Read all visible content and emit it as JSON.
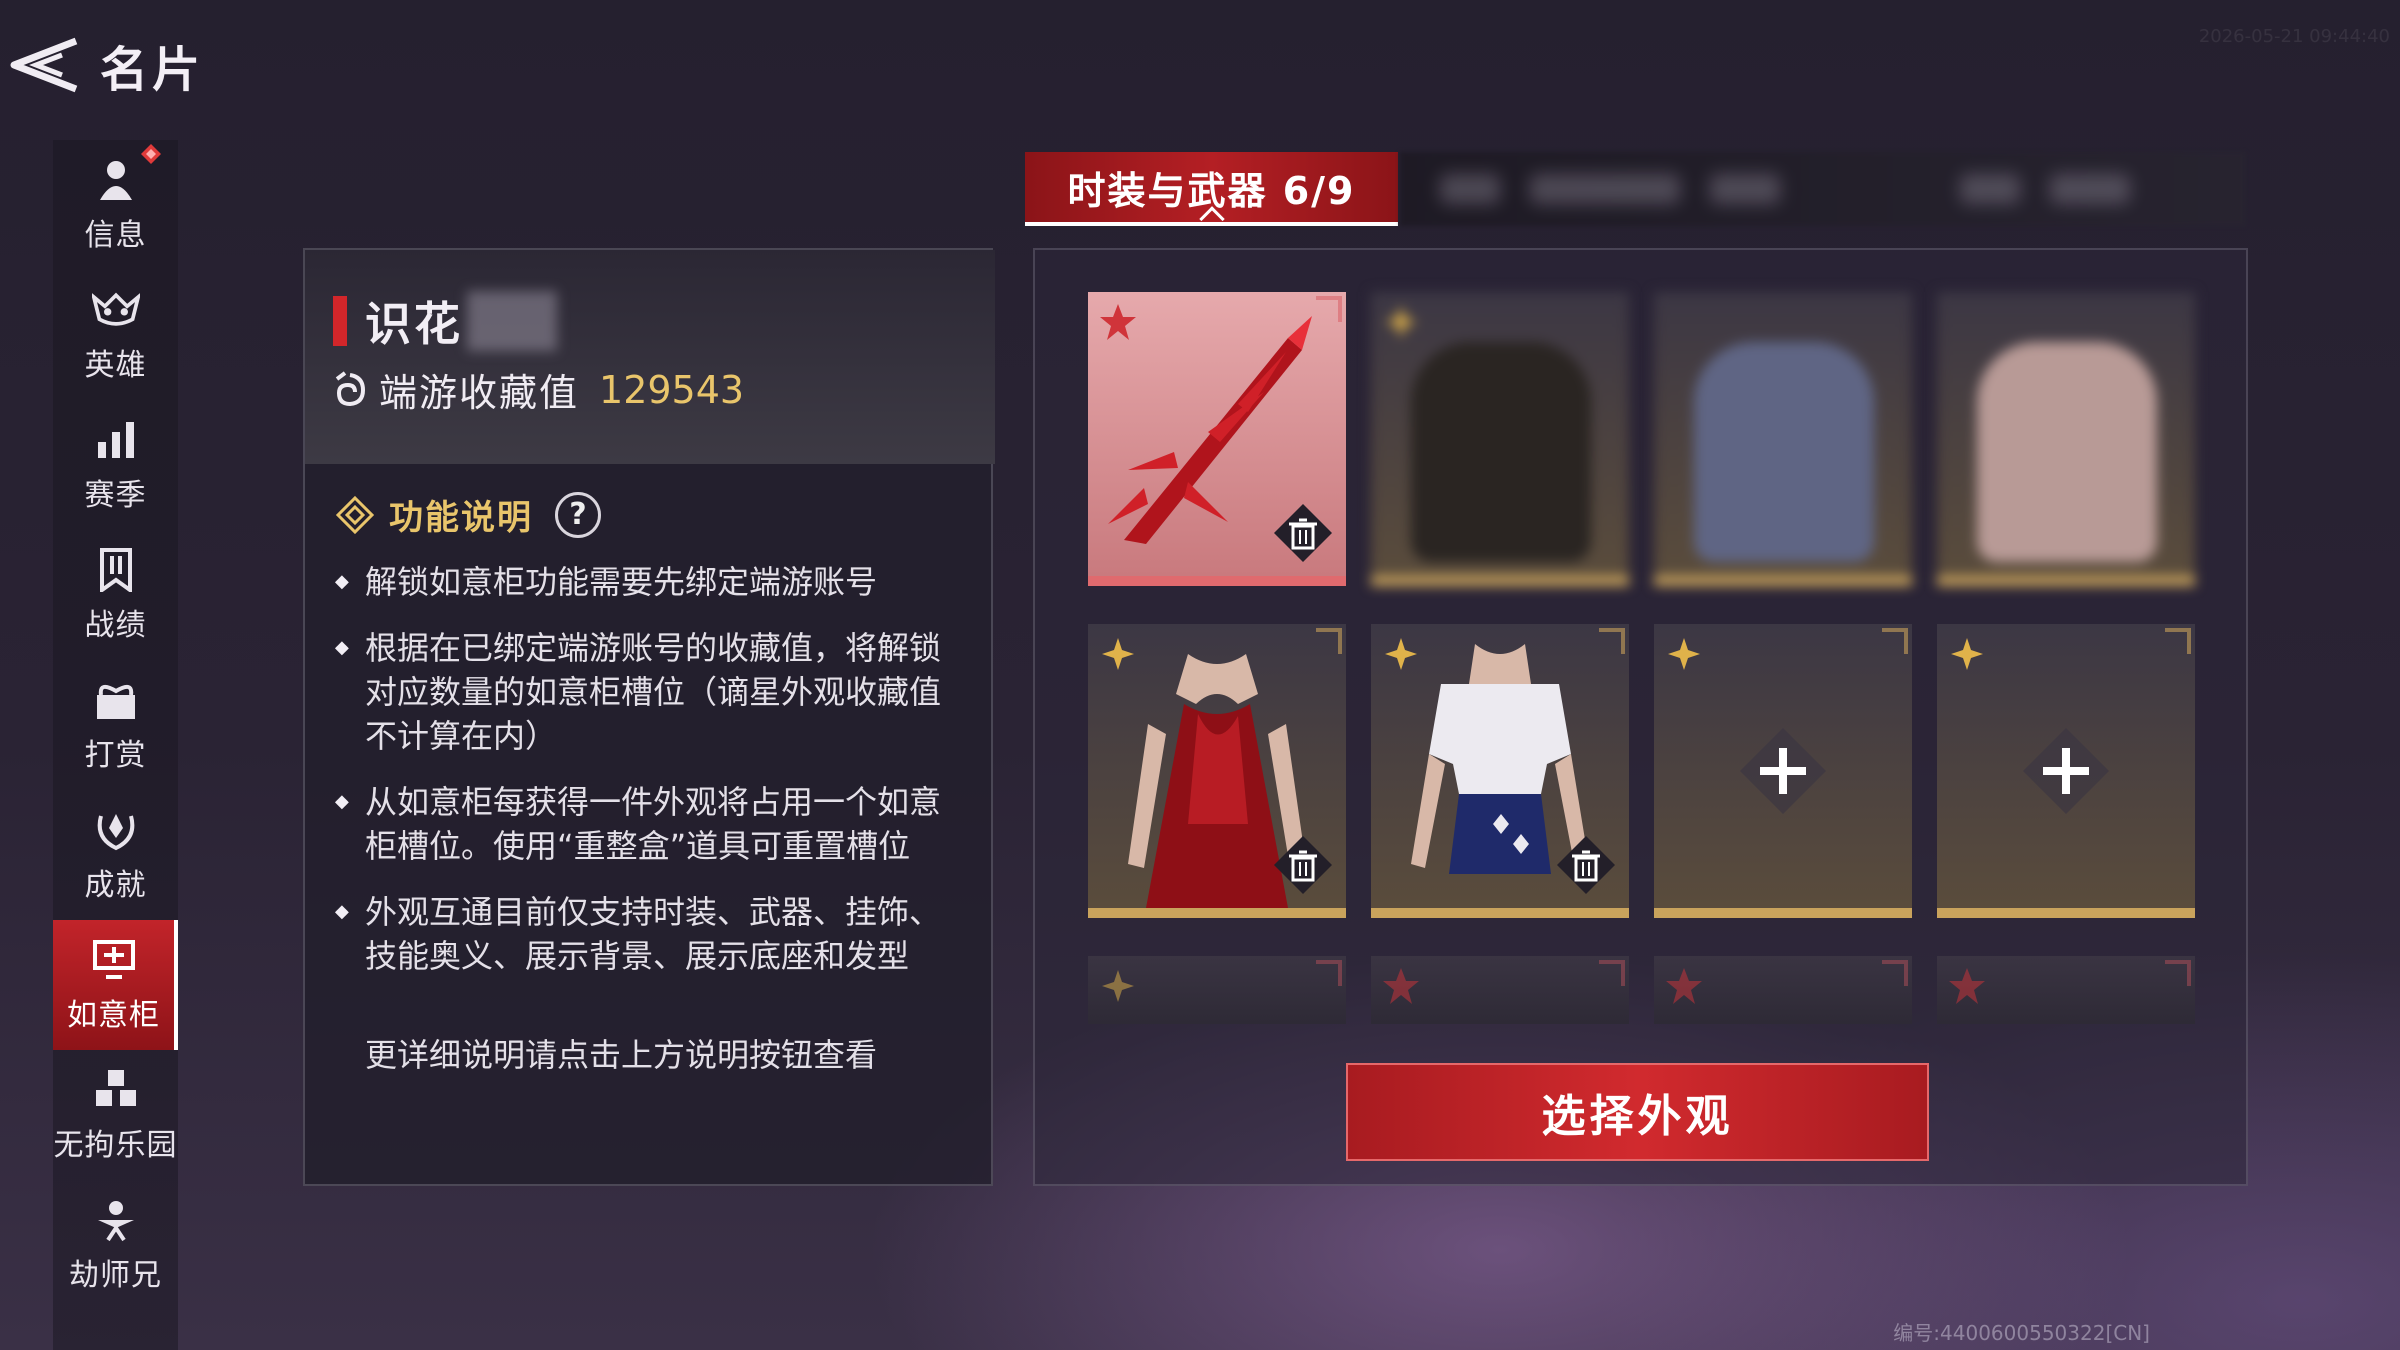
{
  "header": {
    "title": "名片",
    "timestamp": "2026-05-21 09:44:40"
  },
  "sidebar": {
    "items": [
      {
        "label": "信息",
        "icon": "person-icon"
      },
      {
        "label": "英雄",
        "icon": "hero-mask-icon"
      },
      {
        "label": "赛季",
        "icon": "bar-chart-icon"
      },
      {
        "label": "战绩",
        "icon": "banner-icon"
      },
      {
        "label": "打赏",
        "icon": "gift-icon"
      },
      {
        "label": "成就",
        "icon": "laurel-icon"
      },
      {
        "label": "如意柜",
        "icon": "cabinet-icon",
        "active": true
      },
      {
        "label": "无拘乐园",
        "icon": "cubes-icon"
      },
      {
        "label": "劫师兄",
        "icon": "master-icon"
      }
    ]
  },
  "info": {
    "player_name": "识花",
    "collection_label": "端游收藏值",
    "collection_value": "129543",
    "func_title": "功能说明",
    "help_symbol": "?",
    "rules": [
      "解锁如意柜功能需要先绑定端游账号",
      "根据在已绑定端游账号的收藏值，将解锁对应数量的如意柜槽位（谪星外观收藏值不计算在内）",
      "从如意柜每获得一件外观将占用一个如意柜槽位。使用“重整盒”道具可重置槽位",
      "外观互通目前仅支持时装、武器、挂饰、技能奥义、展示背景、展示底座和发型"
    ],
    "footnote": "更详细说明请点击上方说明按钮查看"
  },
  "tabs": {
    "active_label": "时装与武器 6/9"
  },
  "slots": [
    {
      "kind": "weapon",
      "rarity": "red",
      "deletable": true
    },
    {
      "kind": "blurred",
      "rarity": "gold",
      "deletable": false
    },
    {
      "kind": "blurred",
      "rarity": "gold",
      "deletable": false
    },
    {
      "kind": "blurred",
      "rarity": "gold",
      "deletable": false
    },
    {
      "kind": "red-dress",
      "rarity": "gold",
      "deletable": true
    },
    {
      "kind": "sailor-outfit",
      "rarity": "gold",
      "deletable": true
    },
    {
      "kind": "empty",
      "rarity": "gold",
      "deletable": false
    },
    {
      "kind": "empty",
      "rarity": "gold",
      "deletable": false
    }
  ],
  "select_button": "选择外观",
  "serial": "编号:4400600550322[CN]",
  "colors": {
    "accent_red": "#c2242a",
    "gold": "#e9c56b",
    "card_border": "#c9a35c"
  }
}
